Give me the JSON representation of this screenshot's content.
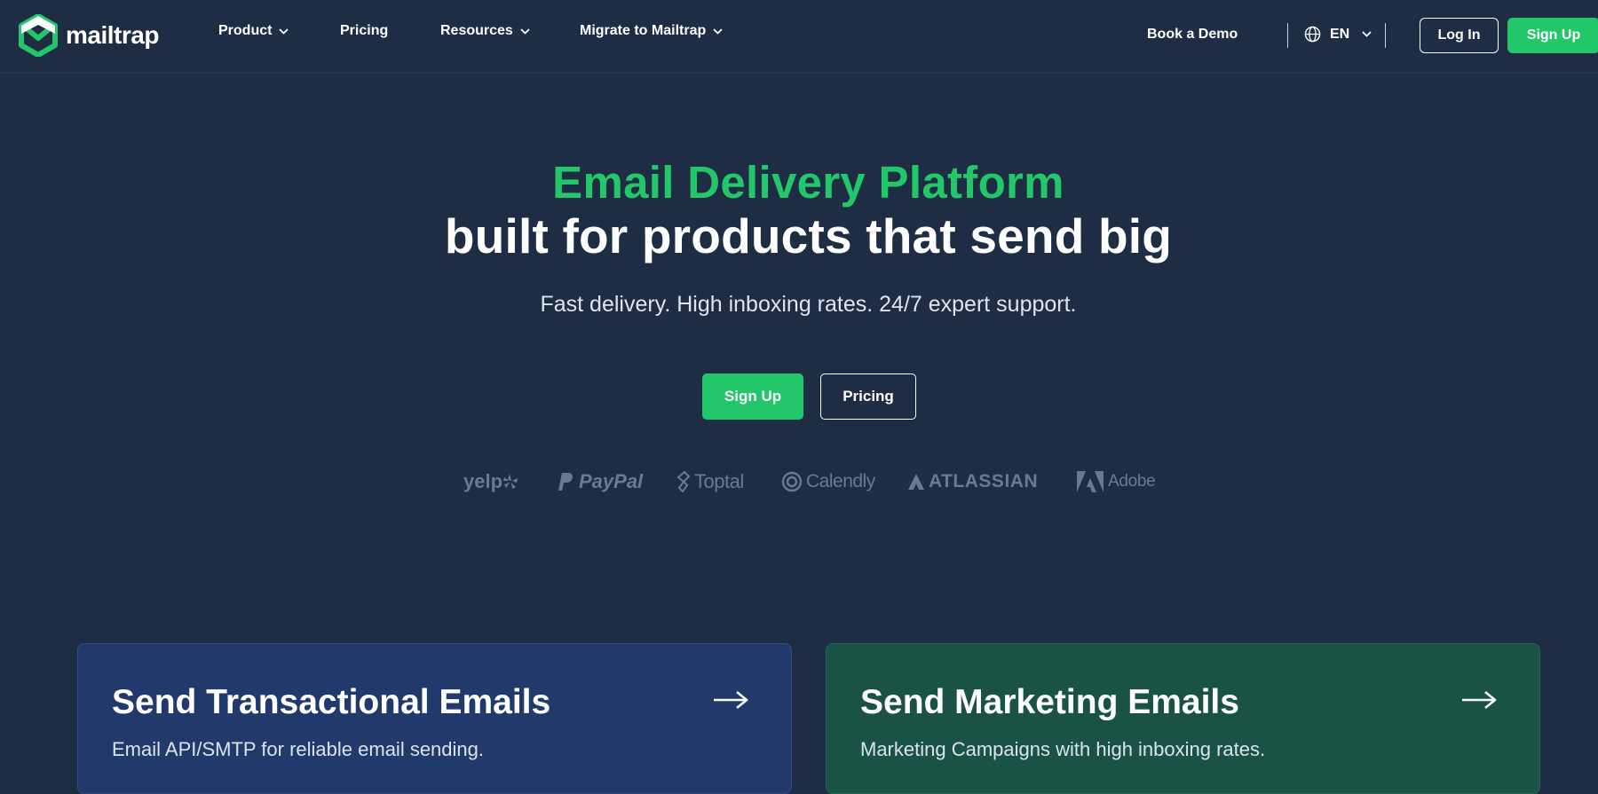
{
  "brand": {
    "name": "mailtrap",
    "accent": "#22c76a",
    "background": "#1e2c44"
  },
  "nav": {
    "items": [
      {
        "label": "Product",
        "has_dropdown": true
      },
      {
        "label": "Pricing",
        "has_dropdown": false
      },
      {
        "label": "Resources",
        "has_dropdown": true
      },
      {
        "label": "Migrate to Mailtrap",
        "has_dropdown": true
      }
    ],
    "book_demo": "Book a Demo",
    "language": "EN",
    "login": "Log In",
    "signup": "Sign Up"
  },
  "hero": {
    "title_line1": "Email Delivery Platform",
    "title_line2": "built for products that send big",
    "subtitle": "Fast delivery. High inboxing rates. 24/7 expert support.",
    "signup": "Sign Up",
    "pricing": "Pricing"
  },
  "clients": [
    "yelp",
    "PayPal",
    "Toptal",
    "Calendly",
    "ATLASSIAN",
    "Adobe"
  ],
  "cards": [
    {
      "title": "Send Transactional Emails",
      "description": "Email API/SMTP for reliable email sending.",
      "icon": "arrow-right-icon",
      "color": "#213a6b"
    },
    {
      "title": "Send Marketing Emails",
      "description": "Marketing Campaigns with high inboxing rates.",
      "icon": "arrow-right-icon",
      "color": "#1a5345"
    }
  ]
}
